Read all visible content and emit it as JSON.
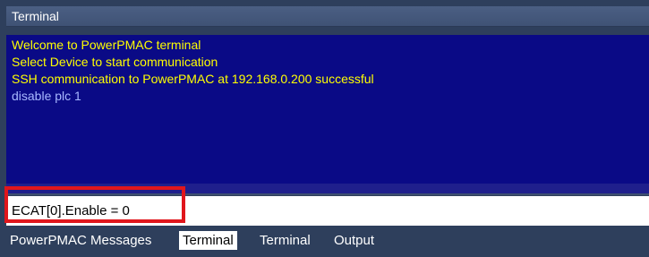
{
  "panel": {
    "title": "Terminal"
  },
  "output": {
    "lines": [
      {
        "text": "Welcome to PowerPMAC terminal",
        "kind": "sys"
      },
      {
        "text": "Select Device to start communication",
        "kind": "sys"
      },
      {
        "text": "SSH communication to PowerPMAC at 192.168.0.200 successful",
        "kind": "sys"
      },
      {
        "text": "disable plc 1",
        "kind": "cmd"
      }
    ],
    "system_color": "#ffff00",
    "command_color": "#a8b8ff",
    "background": "#0a0a86"
  },
  "input": {
    "value": "ECAT[0].Enable = 0"
  },
  "annotation": {
    "color": "#e0161c"
  },
  "tabs": [
    {
      "label": "PowerPMAC Messages",
      "active": false
    },
    {
      "label": "Terminal",
      "active": true
    },
    {
      "label": "Terminal",
      "active": false
    },
    {
      "label": "Output",
      "active": false
    }
  ]
}
